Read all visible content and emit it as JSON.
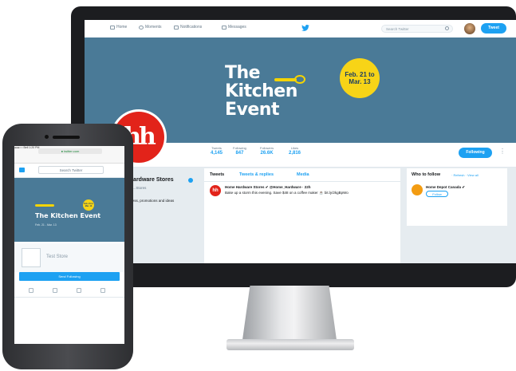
{
  "desktop": {
    "nav": {
      "home": "Home",
      "moments": "Moments",
      "notifications": "Notifications",
      "messages": "Messages",
      "search_placeholder": "Search Twitter",
      "tweet_button": "Tweet"
    },
    "banner": {
      "line1": "The",
      "line2": "Kitchen",
      "line3": "Event",
      "date_line1": "Feb. 21 to",
      "date_line2": "Mar. 13"
    },
    "avatar_logo": "hh",
    "stats": [
      {
        "label": "Tweets",
        "value": "4,145"
      },
      {
        "label": "Following",
        "value": "847"
      },
      {
        "label": "Followers",
        "value": "26.6K"
      },
      {
        "label": "Likes",
        "value": "2,816"
      }
    ],
    "following_button": "Following",
    "profile": {
      "name": "Hardware Stores",
      "handle": "@...Stores",
      "bio": "...ess, promotions and ideas"
    },
    "timeline": {
      "tabs": [
        "Tweets",
        "Tweets & replies",
        "Media"
      ],
      "tweet_author": "Home Hardware Stores ✔ @Home_Hardware · 22h",
      "tweet_text": "Bake up a storm this evening. Save $48 on a coffee maker ☕ bit.ly/2kgBpWo"
    },
    "who_to_follow": {
      "title": "Who to follow",
      "links": "· Refresh · View all",
      "name": "Home Depot Canada ✔",
      "follow_button": "Follow"
    }
  },
  "phone": {
    "status": "●●●○○ Bell  1:20 PM",
    "url": "● twitter.com",
    "search_placeholder": "Search Twitter",
    "headline": "The Kitchen Event",
    "date_line1": "Feb. 21 to",
    "date_line2": "Mar. 13",
    "sub": "Feb. 21 - Mar. 13",
    "store_label": "Test Store",
    "follow_bar": "Send Following"
  },
  "colors": {
    "twitter_blue": "#1da1f2",
    "banner_blue": "#4a7a97",
    "accent_yellow": "#f7d417",
    "brand_red": "#e2231a"
  }
}
